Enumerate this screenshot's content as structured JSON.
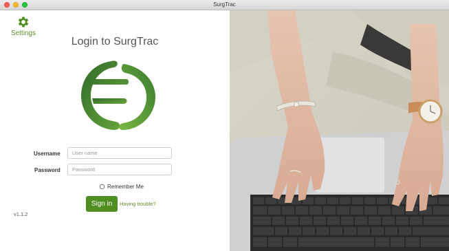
{
  "window": {
    "title": "SurgTrac"
  },
  "settings": {
    "label": "Settings",
    "icon": "gear-icon"
  },
  "login": {
    "heading": "Login to SurgTrac",
    "username_label": "Username",
    "username_placeholder": "User name",
    "password_label": "Password",
    "password_placeholder": "Password",
    "remember_label": "Remember Me",
    "signin_label": "Sign in",
    "trouble_label": "Having trouble?"
  },
  "version": "v1.1.2",
  "colors": {
    "brand_green": "#4f8f22",
    "link_green": "#5c8f2a"
  }
}
